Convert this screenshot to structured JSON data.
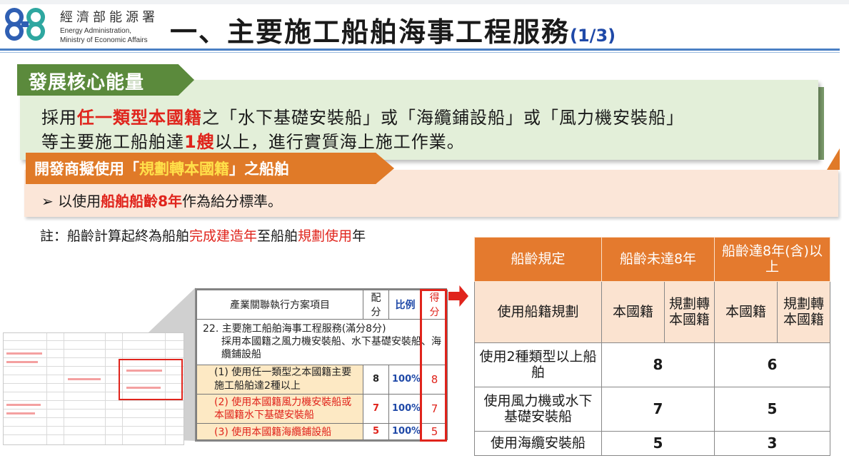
{
  "org": {
    "name_zh": "經濟部能源署",
    "name_en_1": "Energy Administration,",
    "name_en_2": "Ministry of Economic Affairs"
  },
  "title": {
    "main": "一、主要施工船舶海事工程服務",
    "page": "(1/3)"
  },
  "core": {
    "tab": "發展核心能量",
    "line1": {
      "a": "採用",
      "b": "任一類型本國籍",
      "c": "之「水下基礎安裝船」或「海纜鋪設船」或「風力機安裝船」"
    },
    "line2": {
      "a": "等主要施工船舶達",
      "b": "1艘",
      "c": "以上，進行實質海上施工作業。"
    }
  },
  "developer": {
    "tab": {
      "a": "開發商擬使用「",
      "b": "規劃轉本國籍",
      "c": "」之船舶"
    },
    "bullet": "➢",
    "line": {
      "a": "以使用",
      "b": "船舶船齡8年",
      "c": "作為給分標準。"
    }
  },
  "note": {
    "a": "註：船齡計算起終為船舶",
    "b": "完成建造年",
    "c": "至船舶",
    "d": "規劃使用",
    "e": "年"
  },
  "mid_table": {
    "headers": [
      "產業關聯執行方案項目",
      "配分",
      "比例",
      "得分"
    ],
    "item_title": "22. 主要施工船舶海事工程服務(滿分8分)",
    "item_desc": "採用本國籍之風力機安裝船、水下基礎安裝船、海纜鋪設船",
    "rows": [
      {
        "label": "(1) 使用任一類型之本國籍主要施工船舶達2種以上",
        "score": "8",
        "ratio": "100%",
        "got": "8"
      },
      {
        "label": "(2) 使用本國籍風力機安裝船或本國籍水下基礎安裝船",
        "score": "7",
        "ratio": "100%",
        "got": "7"
      },
      {
        "label": "(3) 使用本國籍海纜鋪設船",
        "score": "5",
        "ratio": "100%",
        "got": "5"
      }
    ]
  },
  "right_table": {
    "h_label": "船齡規定",
    "h_under8": "船齡未達8年",
    "h_over8": "船齡達8年(含)以上",
    "sub_label": "使用船籍規劃",
    "sub_native": "本國籍",
    "sub_planned": "規劃轉本國籍",
    "rows": [
      {
        "label": "使用2種類型以上船舶",
        "under8": "8",
        "over8": "6"
      },
      {
        "label": "使用風力機或水下基礎安裝船",
        "under8": "7",
        "over8": "5"
      },
      {
        "label": "使用海纜安裝船",
        "under8": "5",
        "over8": "3"
      }
    ]
  }
}
